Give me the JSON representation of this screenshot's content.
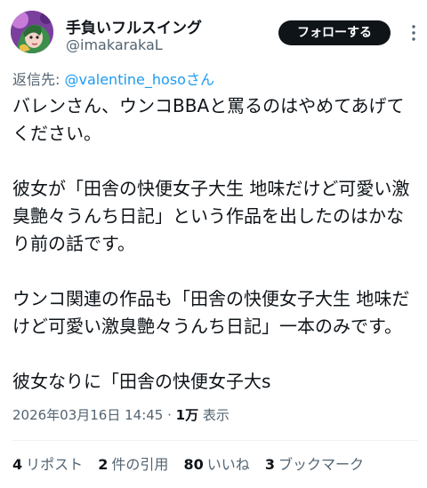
{
  "author": {
    "display_name": "手負いフルスイング",
    "handle": "@imakarakaL",
    "avatar_icon": "anime-avatar-icon"
  },
  "follow_label": "フォローする",
  "more_icon": "more-options-icon",
  "reply": {
    "prefix": "返信先: ",
    "mention": "@valentine_hosoさん"
  },
  "tweet_text": "バレンさん、ウンコBBAと罵るのはやめてあげてください。\n\n彼女が「田舎の快便女子大生 地味だけど可愛い激臭艶々うんち日記」という作品を出したのはかなり前の話です。\n\nウンコ関連の作品も「田舎の快便女子大生 地味だけど可愛い激臭艶々うんち日記」一本のみです。\n\n彼女なりに「田舎の快便女子大s",
  "meta": {
    "timestamp": "2026年03月16日 14:45",
    "separator": " · ",
    "views_count": "1万",
    "views_label": " 表示"
  },
  "stats": [
    {
      "count": "4",
      "label": "リポスト"
    },
    {
      "count": "2",
      "label": "件の引用"
    },
    {
      "count": "80",
      "label": "いいね"
    },
    {
      "count": "3",
      "label": "ブックマーク"
    }
  ],
  "colors": {
    "text": "#0f1419",
    "secondary": "#536471",
    "link": "#1d9bf0",
    "button_bg": "#0f1419"
  }
}
